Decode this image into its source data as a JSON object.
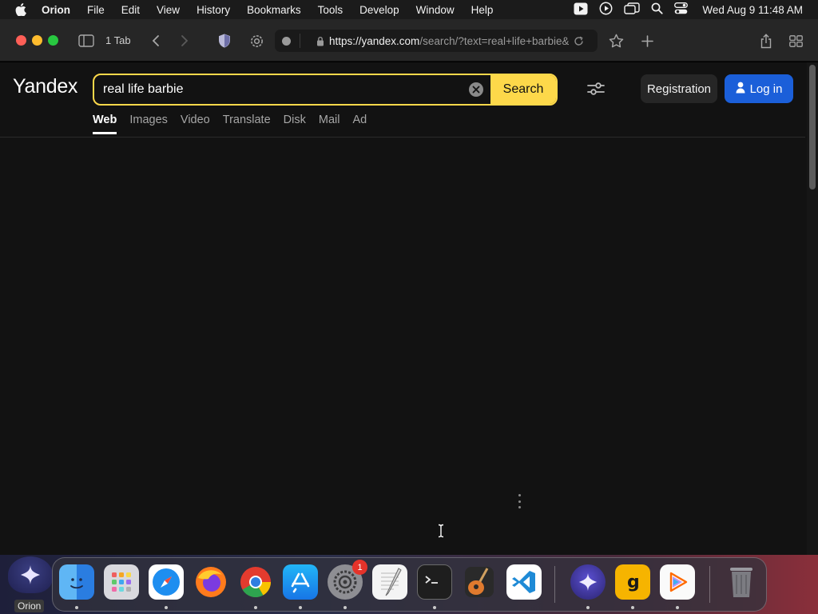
{
  "menubar": {
    "app_name": "Orion",
    "items": [
      "File",
      "Edit",
      "View",
      "History",
      "Bookmarks",
      "Tools",
      "Develop",
      "Window",
      "Help"
    ],
    "clock": "Wed Aug 9  11:48 AM",
    "status_icons": [
      "media-play-icon",
      "screen-record-icon",
      "screen-mirroring-icon",
      "spotlight-search-icon",
      "control-center-icon"
    ]
  },
  "toolbar": {
    "tab_count": "1 Tab",
    "url_host": "https://yandex.com",
    "url_path": "/search/?text=real+life+barbie&"
  },
  "page": {
    "logo": "Yandex",
    "search": {
      "value": "real life barbie",
      "button": "Search"
    },
    "registration": "Registration",
    "login": "Log in",
    "tabs": [
      {
        "label": "Web",
        "active": true
      },
      {
        "label": "Images"
      },
      {
        "label": "Video"
      },
      {
        "label": "Translate"
      },
      {
        "label": "Disk"
      },
      {
        "label": "Mail"
      },
      {
        "label": "Ad"
      }
    ]
  },
  "desktop": {
    "orion_label": "Orion"
  },
  "dock": {
    "apps": [
      "Finder",
      "Launchpad",
      "Safari",
      "Firefox",
      "Chrome",
      "App Store",
      "System Settings",
      "TextEdit",
      "Terminal",
      "GarageBand",
      "Visual Studio Code",
      "Orion",
      "Grammarly",
      "Infuse",
      "Trash"
    ],
    "system_settings_badge": "1"
  },
  "colors": {
    "accent_yellow": "#fdd84a",
    "login_blue": "#1b5fd9",
    "page_bg": "#121212"
  }
}
